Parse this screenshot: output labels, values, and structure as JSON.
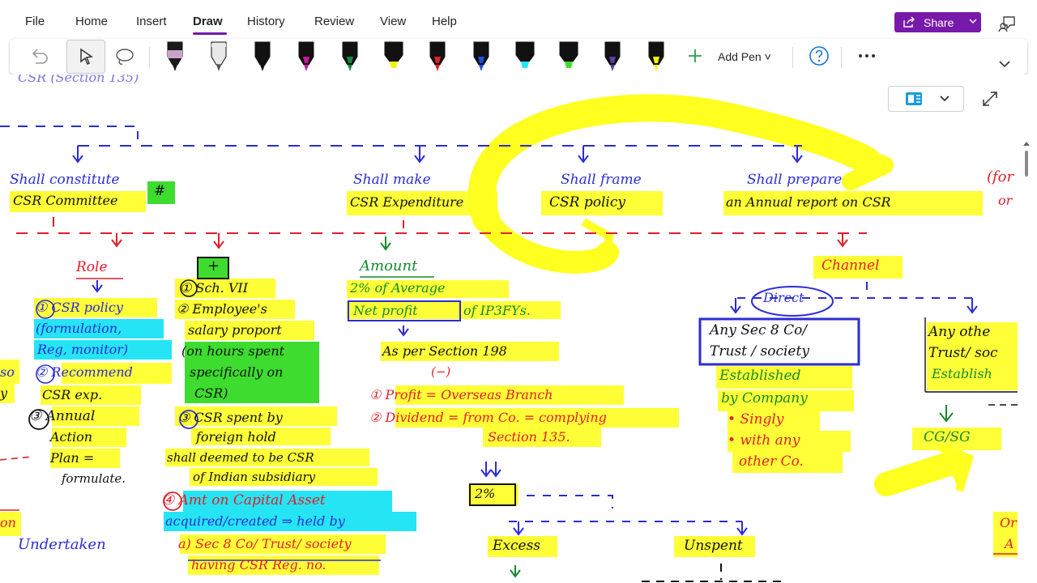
{
  "menu": {
    "file": "File",
    "home": "Home",
    "insert": "Insert",
    "draw": "Draw",
    "history": "History",
    "review": "Review",
    "view": "View",
    "help": "Help"
  },
  "share": {
    "label": "Share"
  },
  "toolbar": {
    "add_pen_label": "Add Pen",
    "pens": [
      {
        "name": "black-pen",
        "color": "#1a1a1a",
        "band": "#c9a3c9"
      },
      {
        "name": "gray-pencil",
        "color": "#555555",
        "band": "#e8e8e8"
      },
      {
        "name": "black-pen-2",
        "color": "#111111",
        "band": "#111111"
      },
      {
        "name": "magenta-pen",
        "color": "#c8189c",
        "band": "#111111"
      },
      {
        "name": "green-pen",
        "color": "#148a3c",
        "band": "#111111"
      },
      {
        "name": "yellow-highlighter",
        "color": "#f5f200",
        "band": "#111111"
      },
      {
        "name": "red-pen",
        "color": "#e01e2a",
        "band": "#111111"
      },
      {
        "name": "blue-pen",
        "color": "#1b4fe0",
        "band": "#111111"
      },
      {
        "name": "cyan-highlighter",
        "color": "#25e5f5",
        "band": "#111111"
      },
      {
        "name": "green-highlighter",
        "color": "#3ddc2f",
        "band": "#111111"
      },
      {
        "name": "purple-pen",
        "color": "#5b3fa0",
        "band": "#111111"
      },
      {
        "name": "yellow-pen",
        "color": "#f5f200",
        "band": "#111111"
      }
    ]
  },
  "colors": {
    "accent": "#7719aa",
    "highlight_yellow": "#ffff38",
    "highlight_cyan": "#25e5f5",
    "highlight_green": "#3ddc2f",
    "ink_blue": "#2c2cd6",
    "ink_red": "#e01e2a",
    "ink_green": "#158a2e"
  },
  "notes": {
    "top_cut": "CSR (Section 135)",
    "shall_constitute": "Shall constitute",
    "csr_committee": "CSR Committee",
    "hash": "#",
    "shall_make": "Shall make",
    "csr_expenditure": "CSR Expenditure",
    "shall_frame": "Shall frame",
    "csr_policy": "CSR policy",
    "shall_prepare": "Shall prepare",
    "annual_report": "an Annual report on CSR",
    "side_for": "(for",
    "side_or": "or",
    "role": "Role",
    "role_1a": "① CSR policy",
    "role_1b": "(formulation,",
    "role_1c": "Reg, monitor)",
    "role_2a": "② Recommend",
    "role_2b": "CSR exp.",
    "role_3a": "③ Annual",
    "role_3b": "Action",
    "role_3c": "Plan =",
    "role_3d": "formulate.",
    "left_so": "so",
    "left_y": "y",
    "left_on": "on",
    "left_undertaken": "Undertaken",
    "plus": "+",
    "p1": "① Sch. VII",
    "p2a": "② Employee's",
    "p2b": "salary proport",
    "p2c": "(on hours spent",
    "p2d": "specifically on",
    "p2e": "CSR)",
    "p3a": "③ CSR spent by",
    "p3b": "foreign hold",
    "p3c": "shall deemed to be CSR",
    "p3d": "of Indian subsidiary",
    "p4a": "④ Amt on Capital Asset",
    "p4b": "acquired/created ⇒ held by",
    "p4c": "a) Sec 8 Co/ Trust/ society",
    "p4d": "having CSR Reg. no.",
    "amount": "Amount",
    "amount_1": "2% of Average",
    "amount_2": "Net profit",
    "amount_3": "of IP3FYs.",
    "as_per": "As per Section 198",
    "minus": "(−)",
    "ex1": "① Profit = Overseas Branch",
    "ex2a": "② Dividend = from Co. = complying",
    "ex2b": "Section 135.",
    "two_pct": "2%",
    "excess": "Excess",
    "unspent": "Unspent",
    "channel": "Channel",
    "direct": "Direct",
    "any_sec8_a": "Any Sec 8 Co/",
    "any_sec8_b": "Trust / society",
    "est1": "Established",
    "est2": "by Company",
    "est3": "• Singly",
    "est4": "• with any",
    "est5": "other Co.",
    "any_other_a": "Any othe",
    "any_other_b": "Trust/ soc",
    "any_other_c": "Establish",
    "cg_sg": "CG/SG",
    "right_cut": "Or",
    "right_a": "A"
  }
}
